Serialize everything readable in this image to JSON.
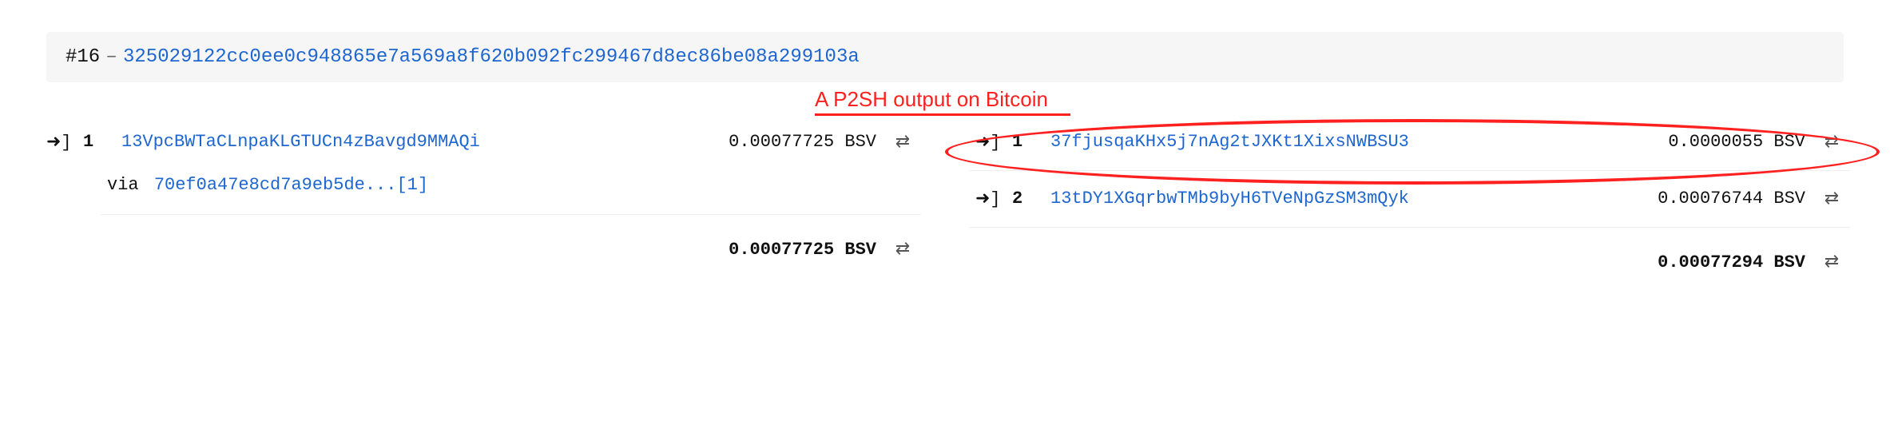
{
  "header": {
    "index_label": "#16",
    "dash": "–",
    "txid": "325029122cc0ee0c948865e7a569a8f620b092fc299467d8ec86be08a299103a"
  },
  "annotation": {
    "text": "A P2SH output on Bitcoin"
  },
  "currency": "BSV",
  "inputs": {
    "items": [
      {
        "index": "1",
        "address": "13VpcBWTaCLnpaKLGTUCn4zBavgd9MMAQi",
        "amount": "0.00077725",
        "via_label": "via",
        "via_link": "70ef0a47e8cd7a9eb5de...[1]"
      }
    ],
    "total": "0.00077725"
  },
  "outputs": {
    "items": [
      {
        "index": "1",
        "address": "37fjusqaKHx5j7nAg2tJXKt1XixsNWBSU3",
        "amount": "0.0000055"
      },
      {
        "index": "2",
        "address": "13tDY1XGqrbwTMb9byH6TVeNpGzSM3mQyk",
        "amount": "0.00076744"
      }
    ],
    "total": "0.00077294"
  }
}
